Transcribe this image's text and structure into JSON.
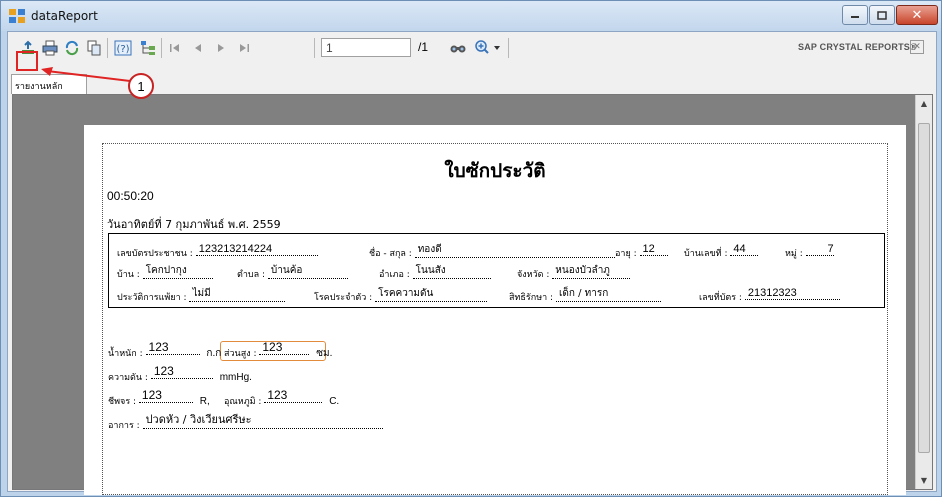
{
  "window": {
    "title": "dataReport"
  },
  "toolbar": {
    "page_value": "1",
    "page_total": "/1",
    "brand": "SAP CRYSTAL REPORTS®",
    "icons": [
      "export-icon",
      "print-icon",
      "refresh-icon",
      "copy-icon",
      "help-icon",
      "group-tree-icon",
      "first-page-icon",
      "prev-page-icon",
      "next-page-icon",
      "last-page-icon",
      "find-icon",
      "zoom-icon"
    ]
  },
  "tab": {
    "label": "รายงานหลัก"
  },
  "annotation": {
    "number": "1",
    "color": "#e02424"
  },
  "report": {
    "title": "ใบซักประวัติ",
    "time": "00:50:20",
    "date": "วันอาทิตย์ที่ 7 กุมภาพันธ์ พ.ศ. 2559",
    "row1": {
      "id_label": "เลขบัตรประชาชน :",
      "id_value": "123213214224",
      "name_label": "ชื่อ - สกุล :",
      "name_value": "ทองดี",
      "age_label": "อายุ :",
      "age_value": "12",
      "house_label": "บ้านเลขที่ :",
      "house_value": "44",
      "moo_label": "หมู่ :",
      "moo_value": "7"
    },
    "row2": {
      "village_label": "บ้าน :",
      "village_value": "โคกปากุง",
      "subdistrict_label": "ตำบล :",
      "subdistrict_value": "บ้านค้อ",
      "district_label": "อำเภอ :",
      "district_value": "โนนสัง",
      "province_label": "จังหวัด :",
      "province_value": "หนองบัวลำภู"
    },
    "row3": {
      "allergy_label": "ประวัติการแพ้ยา :",
      "allergy_value": "ไม่มี",
      "disease_label": "โรคประจำตัว :",
      "disease_value": "โรคความดัน",
      "rights_label": "สิทธิรักษา :",
      "rights_value": "เด็ก / ทารก",
      "card_label": "เลขที่บัตร :",
      "card_value": "21312323"
    },
    "vitals": {
      "weight_label": "น้ำหนัก :",
      "weight_value": "123",
      "weight_unit": "ก.ก",
      "height_label": "ส่วนสูง :",
      "height_value": "123",
      "height_unit": "ซม.",
      "bp_label": "ความดัน :",
      "bp_value": "123",
      "bp_unit": "mmHg.",
      "pulse_label": "ชีพจร :",
      "pulse_value": "123",
      "pulse_unit": "R,",
      "temp_label": "อุณหภูมิ :",
      "temp_value": "123",
      "temp_unit": "C.",
      "symptom_label": "อาการ :",
      "symptom_value": "ปวดหัว / วิงเวียนศรีษะ"
    }
  }
}
